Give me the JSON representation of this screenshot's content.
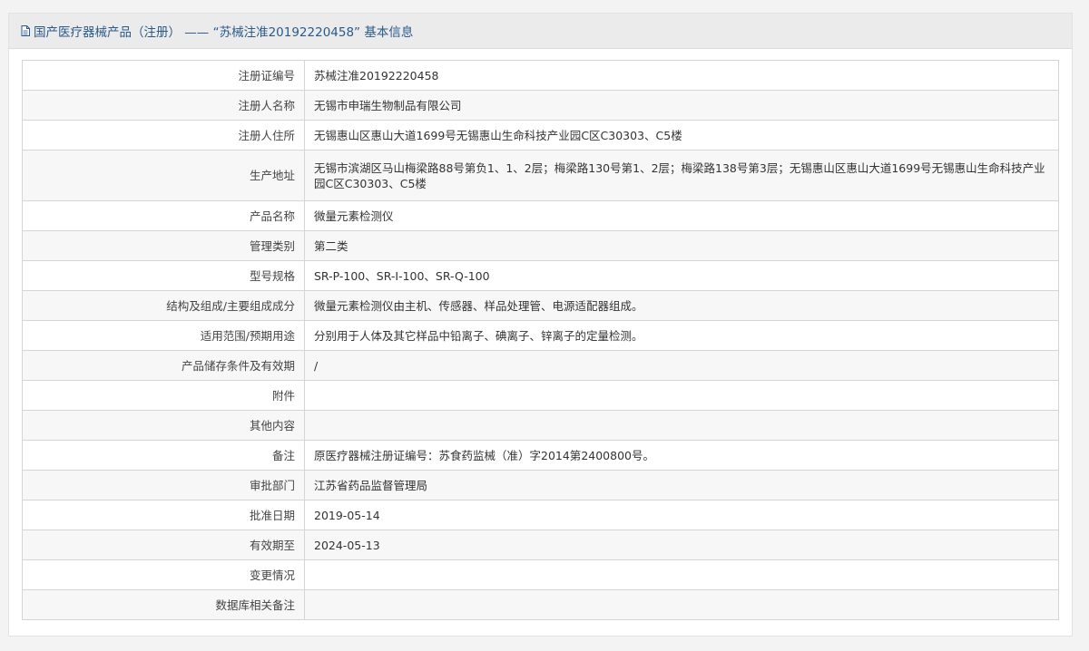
{
  "header": {
    "title": "国产医疗器械产品（注册） —— “苏械注准20192220458” 基本信息"
  },
  "colors": {
    "title": "#2a5a8a",
    "header_bg": "#ebebeb",
    "row_alt_bg": "#f7f7f7",
    "border": "#d5d5d5"
  },
  "rows": [
    {
      "label": "注册证编号",
      "value": "苏械注准20192220458"
    },
    {
      "label": "注册人名称",
      "value": "无锡市申瑞生物制品有限公司"
    },
    {
      "label": "注册人住所",
      "value": "无锡惠山区惠山大道1699号无锡惠山生命科技产业园C区C30303、C5楼"
    },
    {
      "label": "生产地址",
      "value": "无锡市滨湖区马山梅梁路88号第负1、1、2层；梅梁路130号第1、2层；梅梁路138号第3层；无锡惠山区惠山大道1699号无锡惠山生命科技产业园C区C30303、C5楼"
    },
    {
      "label": "产品名称",
      "value": "微量元素检测仪"
    },
    {
      "label": "管理类别",
      "value": "第二类"
    },
    {
      "label": "型号规格",
      "value": "SR-P-100、SR-I-100、SR-Q-100"
    },
    {
      "label": "结构及组成/主要组成成分",
      "value": "微量元素检测仪由主机、传感器、样品处理管、电源适配器组成。"
    },
    {
      "label": "适用范围/预期用途",
      "value": "分别用于人体及其它样品中铅离子、碘离子、锌离子的定量检测。"
    },
    {
      "label": "产品储存条件及有效期",
      "value": "/"
    },
    {
      "label": "附件",
      "value": ""
    },
    {
      "label": "其他内容",
      "value": ""
    },
    {
      "label": "备注",
      "value": "原医疗器械注册证编号：苏食药监械（准）字2014第2400800号。"
    },
    {
      "label": "审批部门",
      "value": "江苏省药品监督管理局"
    },
    {
      "label": "批准日期",
      "value": "2019-05-14"
    },
    {
      "label": "有效期至",
      "value": "2024-05-13"
    },
    {
      "label": "变更情况",
      "value": ""
    },
    {
      "label": "数据库相关备注",
      "value": ""
    }
  ]
}
